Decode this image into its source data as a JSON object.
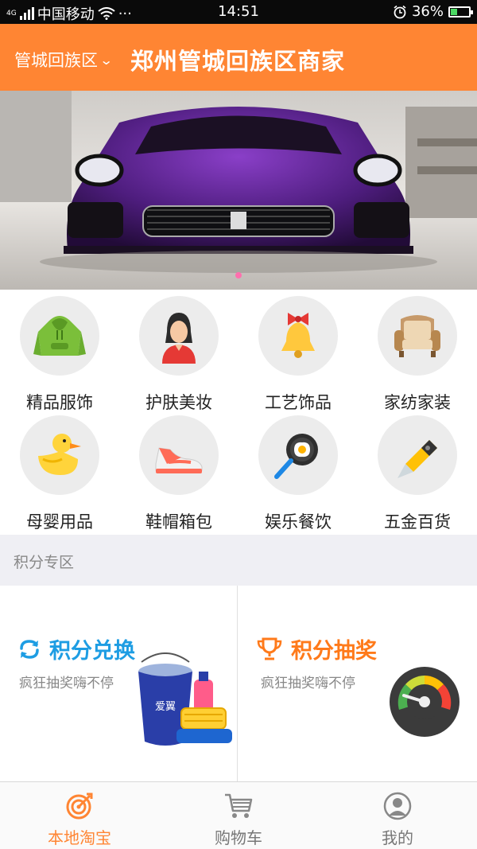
{
  "status_bar": {
    "network": "4G",
    "carrier": "中国移动",
    "more": "···",
    "time": "14:51",
    "battery": "36%",
    "battery_level": 0.36
  },
  "header": {
    "district": "管城回族区",
    "title": "郑州管城回族区商家"
  },
  "banner": {
    "slide_count": 1,
    "active_slide": 0
  },
  "categories": [
    {
      "label": "精品服饰",
      "icon": "hoodie-icon"
    },
    {
      "label": "护肤美妆",
      "icon": "woman-icon"
    },
    {
      "label": "工艺饰品",
      "icon": "bell-icon"
    },
    {
      "label": "家纺家装",
      "icon": "armchair-icon"
    },
    {
      "label": "母婴用品",
      "icon": "duck-icon"
    },
    {
      "label": "鞋帽箱包",
      "icon": "sneaker-icon"
    },
    {
      "label": "娱乐餐饮",
      "icon": "frying-pan-icon"
    },
    {
      "label": "五金百货",
      "icon": "utility-knife-icon"
    }
  ],
  "section": {
    "title": "积分专区"
  },
  "promos": {
    "exchange": {
      "title": "积分兑换",
      "subtitle": "疯狂抽奖嗨不停",
      "color": "#1e9de3",
      "image_text": "爱翼"
    },
    "lottery": {
      "title": "积分抽奖",
      "subtitle": "疯狂抽奖嗨不停",
      "color": "#ff7a1a"
    }
  },
  "tabs": [
    {
      "label": "本地淘宝",
      "icon": "target-icon",
      "active": true
    },
    {
      "label": "购物车",
      "icon": "cart-icon",
      "active": false
    },
    {
      "label": "我的",
      "icon": "user-icon",
      "active": false
    }
  ],
  "colors": {
    "accent": "#ff8533",
    "status_bar": "#0a0a0a",
    "section_bg": "#efeff4"
  }
}
